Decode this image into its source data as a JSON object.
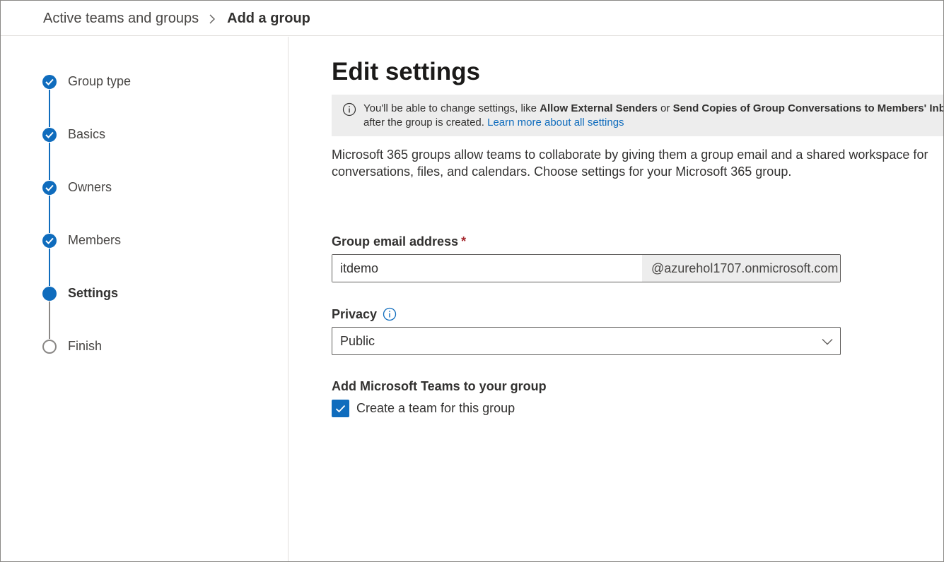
{
  "breadcrumb": {
    "parent": "Active teams and groups",
    "current": "Add a group"
  },
  "steps": [
    {
      "label": "Group type",
      "state": "done"
    },
    {
      "label": "Basics",
      "state": "done"
    },
    {
      "label": "Owners",
      "state": "done"
    },
    {
      "label": "Members",
      "state": "done"
    },
    {
      "label": "Settings",
      "state": "current"
    },
    {
      "label": "Finish",
      "state": "todo"
    }
  ],
  "main": {
    "title": "Edit settings",
    "banner": {
      "text_a": "You'll be able to change settings, like ",
      "bold_a": "Allow External Senders",
      "text_b": " or ",
      "bold_b": "Send Copies of Group Conversations to Members' Inboxes",
      "text_c": "after the group is created. ",
      "link": "Learn more about all settings"
    },
    "description": "Microsoft 365 groups allow teams to collaborate by giving them a group email and a shared workspace for conversations, files, and calendars. Choose settings for your Microsoft 365 group.",
    "email": {
      "label": "Group email address",
      "required_mark": "*",
      "value": "itdemo",
      "suffix": "@azurehol1707.onmicrosoft.com"
    },
    "privacy": {
      "label": "Privacy",
      "selected": "Public"
    },
    "teams": {
      "label": "Add Microsoft Teams to your group",
      "checkbox_label": "Create a team for this group",
      "checked": true
    }
  },
  "colors": {
    "accent": "#0f6cbd",
    "banner_bg": "#ededed",
    "required": "#a4262c"
  }
}
